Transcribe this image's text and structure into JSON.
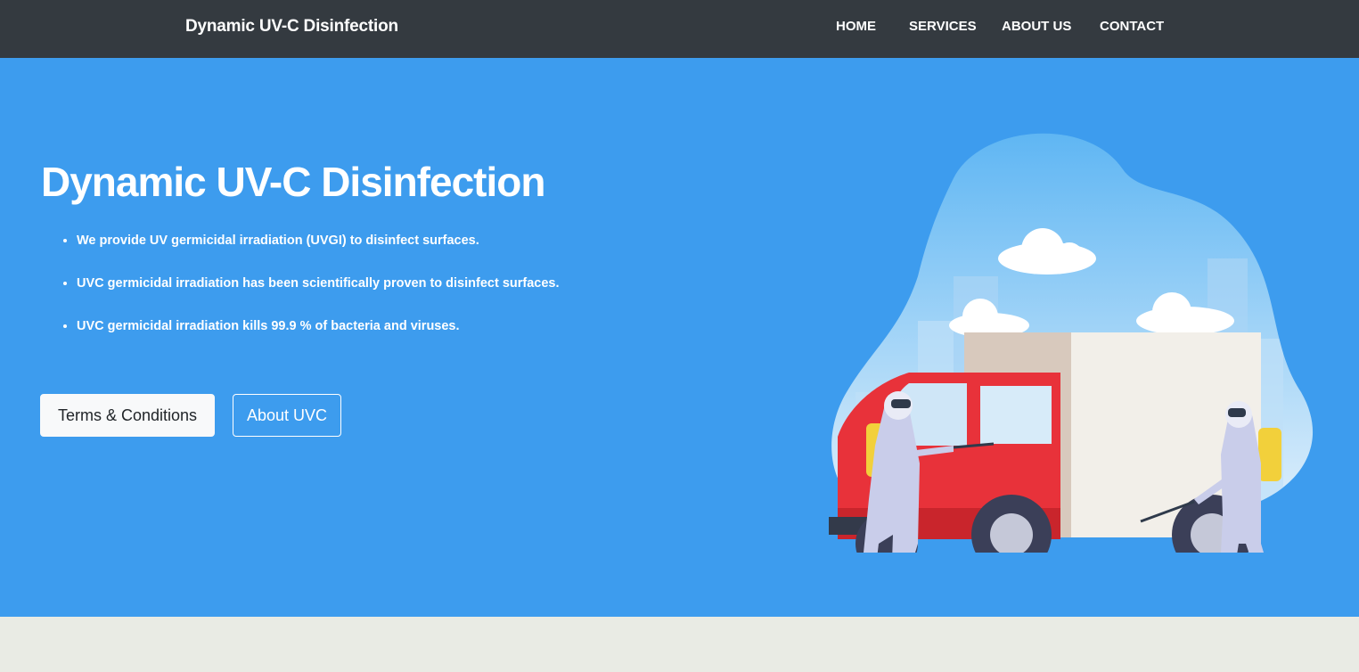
{
  "navbar": {
    "brand": "Dynamic UV-C Disinfection",
    "links": [
      {
        "label": "HOME"
      },
      {
        "label": "SERVICES"
      },
      {
        "label": "ABOUT US"
      },
      {
        "label": "CONTACT"
      }
    ]
  },
  "hero": {
    "title": "Dynamic UV-C Disinfection",
    "bullets": [
      "We provide UV germicidal irradiation (UVGI) to disinfect surfaces.",
      "UVC germicidal irradiation has been scientifically proven to disinfect surfaces.",
      "UVC germicidal irradiation kills 99.9 % of bacteria and viruses."
    ],
    "buttons": {
      "terms_label": "Terms & Conditions",
      "about_label": "About UVC"
    }
  },
  "colors": {
    "navbar_bg": "#343a40",
    "hero_bg": "#3d9cee",
    "footer_bg": "#e9ebe4"
  },
  "illustration": {
    "icon": "disinfection-truck-illustration"
  }
}
